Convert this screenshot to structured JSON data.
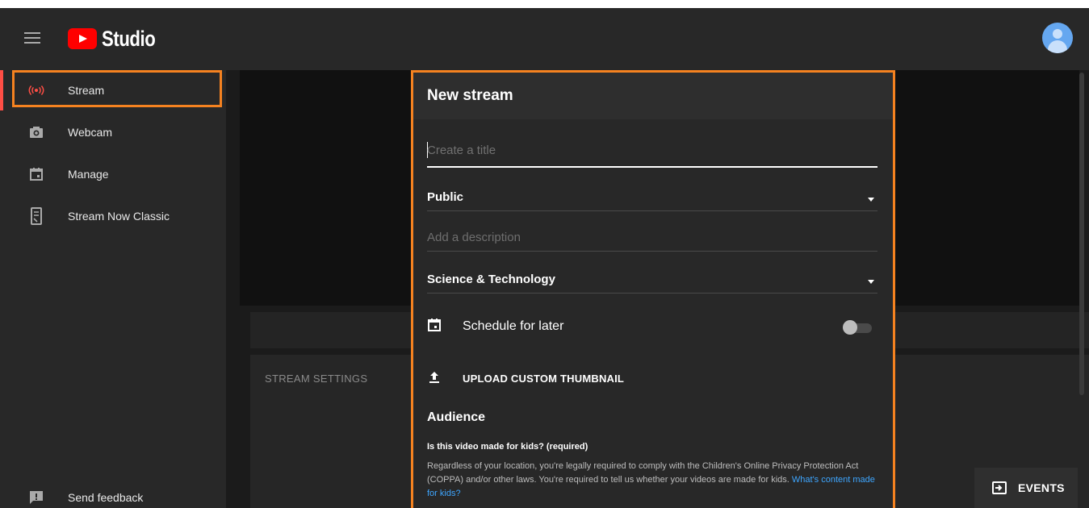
{
  "header": {
    "logo_text": "Studio"
  },
  "sidebar": {
    "items": [
      {
        "label": "Stream",
        "icon": "live-broadcast-icon",
        "active": true
      },
      {
        "label": "Webcam",
        "icon": "camera-icon"
      },
      {
        "label": "Manage",
        "icon": "calendar-icon"
      },
      {
        "label": "Stream Now Classic",
        "icon": "phone-stream-icon"
      }
    ],
    "feedback_label": "Send feedback"
  },
  "main": {
    "settings_label": "STREAM SETTINGS",
    "events_label": "EVENTS"
  },
  "modal": {
    "title": "New stream",
    "title_placeholder": "Create a title",
    "visibility": "Public",
    "description_placeholder": "Add a description",
    "category": "Science & Technology",
    "schedule_label": "Schedule for later",
    "schedule_on": false,
    "upload_label": "UPLOAD CUSTOM THUMBNAIL",
    "audience_heading": "Audience",
    "audience_question": "Is this video made for kids? (required)",
    "audience_text": "Regardless of your location, you're legally required to comply with the Children's Online Privacy Protection Act (COPPA) and/or other laws. You're required to tell us whether your videos are made for kids.",
    "audience_link": "What's content made for kids?"
  },
  "colors": {
    "accent_live": "#ff4e45",
    "highlight_outline": "#f58220",
    "link": "#3ea6ff",
    "brand_red": "#ff0000"
  }
}
